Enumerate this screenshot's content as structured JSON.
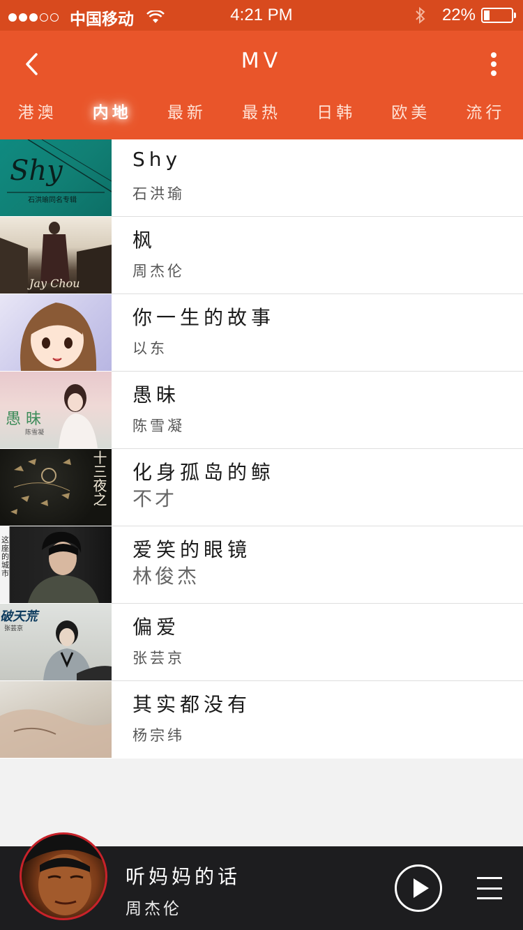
{
  "status_bar": {
    "carrier": "中国移动",
    "time": "4:21 PM",
    "battery": "22%",
    "battery_level": 0.22,
    "signal_bars_filled": 3,
    "signal_bars_total": 5
  },
  "nav": {
    "title": "MV",
    "back_icon": "chevron-left-icon",
    "more_icon": "more-vertical-icon"
  },
  "tabs": [
    {
      "label": "港澳",
      "active": false
    },
    {
      "label": "内地",
      "active": true
    },
    {
      "label": "最新",
      "active": false
    },
    {
      "label": "最热",
      "active": false
    },
    {
      "label": "日韩",
      "active": false
    },
    {
      "label": "欧美",
      "active": false
    },
    {
      "label": "流行",
      "active": false
    }
  ],
  "songs": [
    {
      "title": "Shy",
      "artist": "石洪瑜",
      "thumb_caption": "石洪瑜同名专辑",
      "thumb_logo": "Shy"
    },
    {
      "title": "枫",
      "artist": "周杰伦",
      "thumb_caption": "Jay Chou"
    },
    {
      "title": "你一生的故事",
      "artist": "以东"
    },
    {
      "title": "愚昧",
      "artist": "陈雪凝",
      "thumb_caption": "愚 昧",
      "thumb_sub": "陈雪凝"
    },
    {
      "title": "化身孤岛的鲸",
      "artist": "不才",
      "thumb_caption": "十三夜之"
    },
    {
      "title": "爱笑的眼镜",
      "artist": "林俊杰",
      "thumb_caption": "这座的城市"
    },
    {
      "title": "偏爱",
      "artist": "张芸京",
      "thumb_caption": "破天荒",
      "thumb_sub": "张芸京"
    },
    {
      "title": "其实都没有",
      "artist": "杨宗纬"
    }
  ],
  "player": {
    "title": "听妈妈的话",
    "artist": "周杰伦",
    "play_icon": "play-icon",
    "menu_icon": "menu-icon"
  },
  "colors": {
    "status_bar": "#d84a1e",
    "accent": "#e9552a",
    "player_bg": "#1d1d1f"
  }
}
